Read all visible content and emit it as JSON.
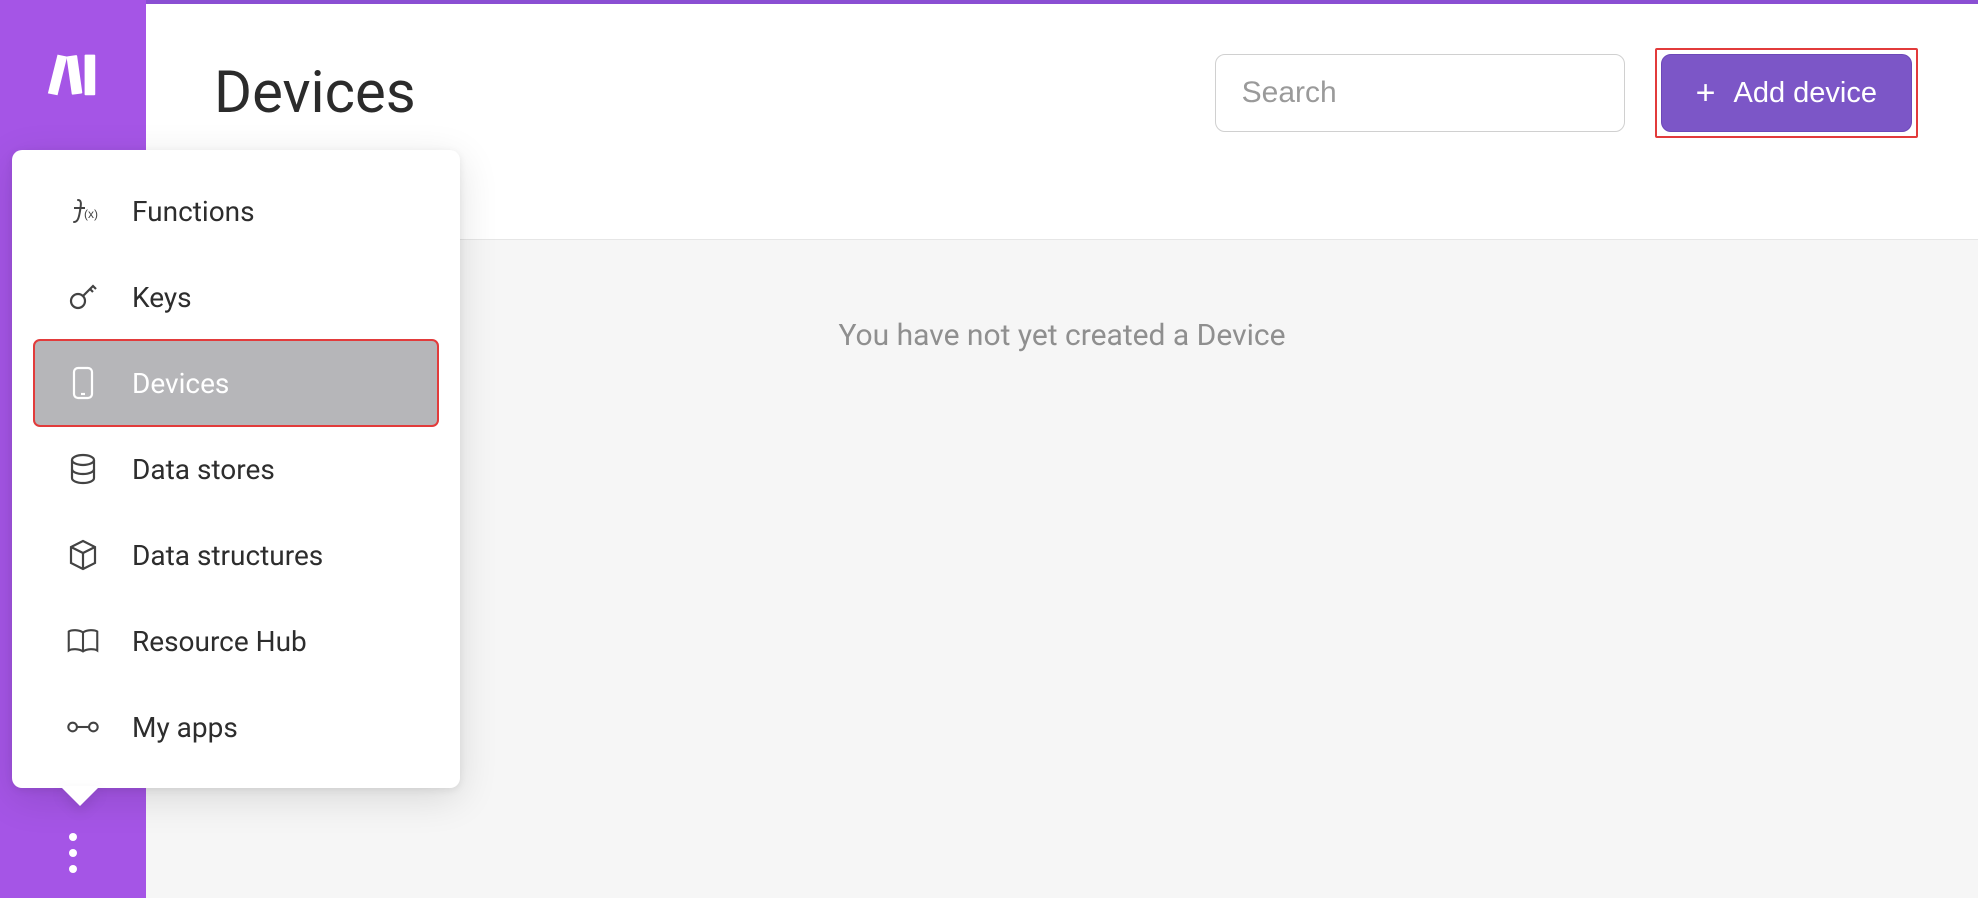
{
  "header": {
    "title": "Devices",
    "search_placeholder": "Search",
    "add_button_label": "Add device"
  },
  "content": {
    "empty_message": "You have not yet created a Device"
  },
  "flyout": {
    "items": [
      {
        "label": "Functions",
        "icon": "function-icon",
        "active": false
      },
      {
        "label": "Keys",
        "icon": "key-icon",
        "active": false
      },
      {
        "label": "Devices",
        "icon": "device-icon",
        "active": true
      },
      {
        "label": "Data stores",
        "icon": "database-icon",
        "active": false
      },
      {
        "label": "Data structures",
        "icon": "cube-icon",
        "active": false
      },
      {
        "label": "Resource Hub",
        "icon": "book-icon",
        "active": false
      },
      {
        "label": "My apps",
        "icon": "apps-icon",
        "active": false
      }
    ]
  },
  "colors": {
    "accent": "#a555e6",
    "button": "#7c56c7",
    "highlight_outline": "#e23b3b"
  }
}
